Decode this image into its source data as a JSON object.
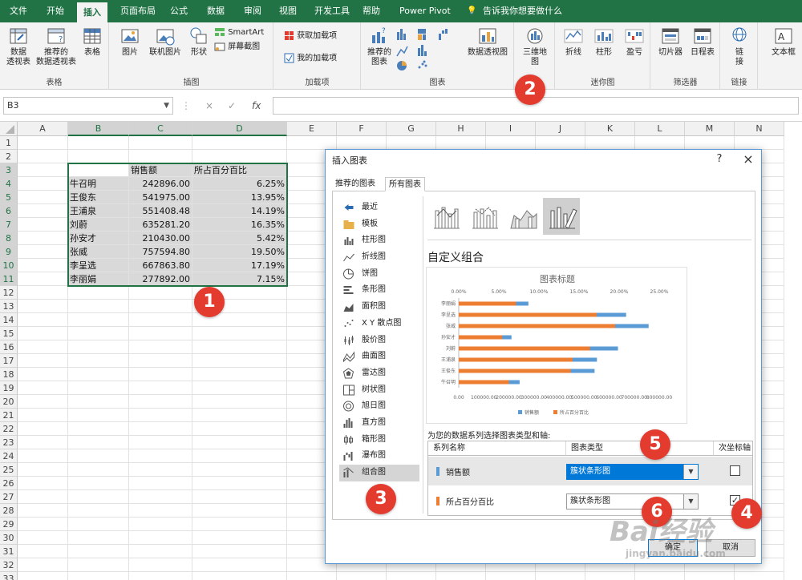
{
  "tabs": [
    "文件",
    "开始",
    "插入",
    "页面布局",
    "公式",
    "数据",
    "审阅",
    "视图",
    "开发工具",
    "帮助",
    "Power Pivot"
  ],
  "active_tab": "插入",
  "tell_me": "告诉我你想要做什么",
  "ribbon": {
    "groups": {
      "tables": "表格",
      "illustrations": "插图",
      "addins": "加载项",
      "charts": "图表",
      "sparklines": "迷你图",
      "filters": "筛选器",
      "links": "链接"
    },
    "buttons": {
      "pivot_table": "数据\n透视表",
      "recommended_pivot": "推荐的\n数据透视表",
      "table": "表格",
      "pictures": "图片",
      "online_pictures": "联机图片",
      "shapes": "形状",
      "smartart": "SmartArt",
      "screenshot": "屏幕截图",
      "get_addins": "获取加载项",
      "my_addins": "我的加载项",
      "recommended_charts": "推荐的\n图表",
      "pivot_chart": "数据透视图",
      "map_3d": "三维地\n图",
      "spark_line": "折线",
      "spark_column": "柱形",
      "spark_winloss": "盈亏",
      "slicer": "切片器",
      "timeline": "日程表",
      "link": "链\n接",
      "textbox": "文本框"
    }
  },
  "namebox": "B3",
  "formula_icons": {
    "cancel": "×",
    "enter": "✓",
    "fx": "fx"
  },
  "columns": [
    "A",
    "B",
    "C",
    "D",
    "E",
    "F",
    "G",
    "H",
    "I",
    "J",
    "K",
    "L",
    "M",
    "N"
  ],
  "rows": [
    "1",
    "2",
    "3",
    "4",
    "5",
    "6",
    "7",
    "8",
    "9",
    "10",
    "11",
    "12",
    "13",
    "14",
    "15",
    "16",
    "17",
    "18",
    "19",
    "20",
    "21",
    "22",
    "23",
    "24",
    "25",
    "26",
    "27",
    "28",
    "29",
    "30",
    "31",
    "32",
    "33"
  ],
  "sheet": {
    "header": [
      "",
      "销售额",
      "所占百分百比"
    ],
    "data": [
      [
        "牛召明",
        "242896.00",
        "6.25%"
      ],
      [
        "王俊东",
        "541975.00",
        "13.95%"
      ],
      [
        "王浦泉",
        "551408.48",
        "14.19%"
      ],
      [
        "刘蔚",
        "635281.20",
        "16.35%"
      ],
      [
        "孙安才",
        "210430.00",
        "5.42%"
      ],
      [
        "张威",
        "757594.80",
        "19.50%"
      ],
      [
        "李呈选",
        "667863.80",
        "17.19%"
      ],
      [
        "李丽娟",
        "277892.00",
        "7.15%"
      ]
    ]
  },
  "markers": [
    "1",
    "2",
    "3",
    "4",
    "5",
    "6"
  ],
  "dialog": {
    "title": "插入图表",
    "help": "?",
    "close": "×",
    "tabs": [
      "推荐的图表",
      "所有图表"
    ],
    "active_tab": "所有图表",
    "types": [
      "最近",
      "模板",
      "柱形图",
      "折线图",
      "饼图",
      "条形图",
      "面积图",
      "X Y 散点图",
      "股价图",
      "曲面图",
      "雷达图",
      "树状图",
      "旭日图",
      "直方图",
      "箱形图",
      "瀑布图",
      "组合图"
    ],
    "active_type": "组合图",
    "combo_title": "自定义组合",
    "series_prompt": "为您的数据系列选择图表类型和轴:",
    "table_headers": [
      "系列名称",
      "图表类型",
      "次坐标轴"
    ],
    "series": [
      {
        "name": "销售额",
        "chart_type": "簇状条形图",
        "secondary": false,
        "color": "#5b9bd5"
      },
      {
        "name": "所占百分百比",
        "chart_type": "簇状条形图",
        "secondary": true,
        "color": "#ed7d31"
      }
    ],
    "ok": "确定",
    "cancel": "取消"
  },
  "chart_data": {
    "type": "bar",
    "title": "图表标题",
    "categories": [
      "牛召明",
      "王俊东",
      "王浦泉",
      "刘蔚",
      "孙安才",
      "张威",
      "李呈选",
      "李丽娟"
    ],
    "series": [
      {
        "name": "销售额",
        "axis": "primary",
        "color": "#5b9bd5",
        "values": [
          242896.0,
          541975.0,
          551408.48,
          635281.2,
          210430.0,
          757594.8,
          667863.8,
          277892.0
        ]
      },
      {
        "name": "所占百分百比",
        "axis": "secondary",
        "color": "#ed7d31",
        "values": [
          6.25,
          13.95,
          14.19,
          16.35,
          5.42,
          19.5,
          17.19,
          7.15
        ]
      }
    ],
    "primary_axis": {
      "position": "bottom",
      "range": [
        0,
        800000
      ],
      "ticks": [
        "0.00",
        "100000.00",
        "200000.00",
        "300000.00",
        "400000.00",
        "500000.00",
        "600000.00",
        "700000.00",
        "800000.00"
      ]
    },
    "secondary_axis": {
      "position": "top",
      "range": [
        0,
        25
      ],
      "ticks": [
        "0.00%",
        "5.00%",
        "10.00%",
        "15.00%",
        "20.00%",
        "25.00%"
      ]
    },
    "legend": "bottom",
    "grid": false
  },
  "watermark": {
    "brand": "Bai经验",
    "url": "jingyan.baidu.com"
  }
}
